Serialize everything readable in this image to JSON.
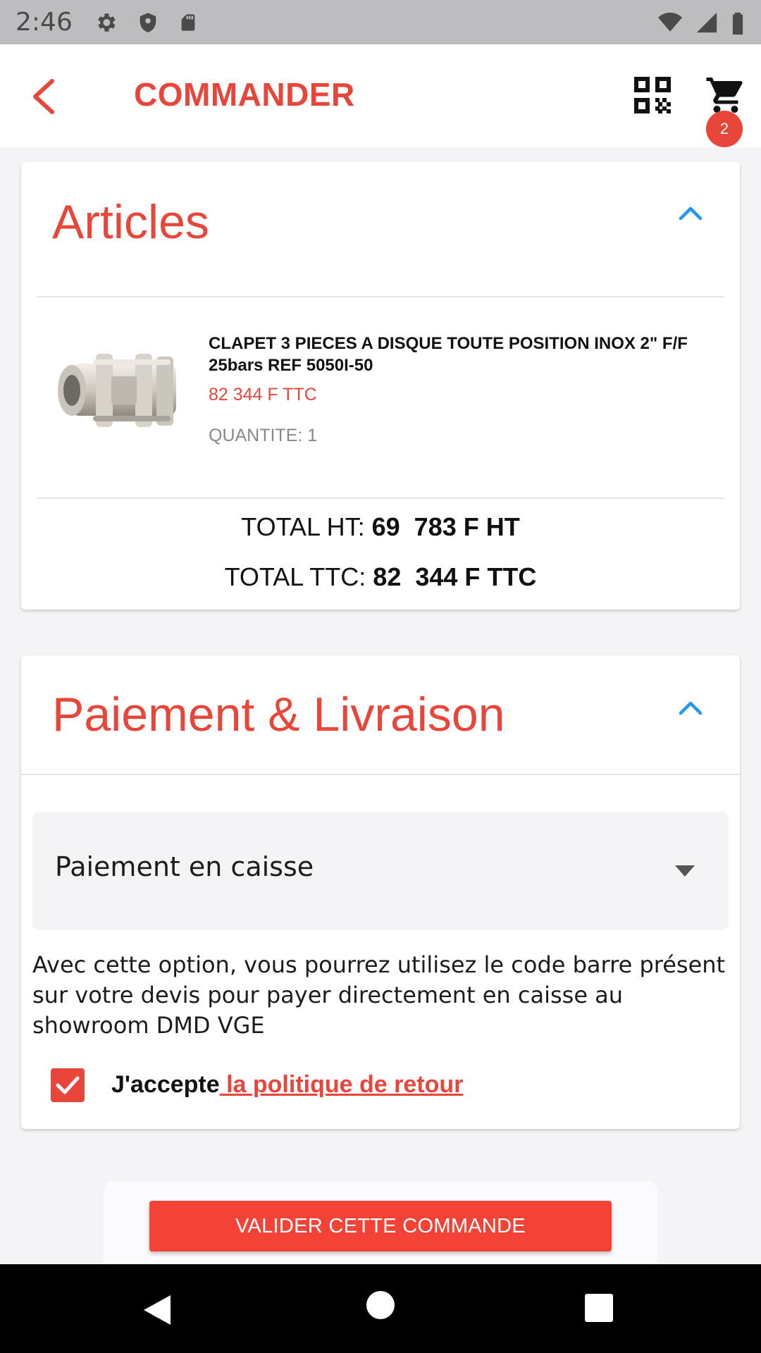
{
  "status_bar": {
    "time": "2:46"
  },
  "app_bar": {
    "title": "COMMANDER",
    "cart_count": "2"
  },
  "articles": {
    "title": "Articles",
    "items": [
      {
        "name": "CLAPET 3 PIECES A DISQUE TOUTE POSITION INOX 2\" F/F 25bars REF 5050I-50",
        "price": "82 344 F TTC",
        "quantity": "QUANTITE: 1"
      }
    ],
    "total_ht_label": "TOTAL HT:",
    "total_ht_value": "69  783 F HT",
    "total_ttc_label": "TOTAL TTC:",
    "total_ttc_value": "82  344 F TTC"
  },
  "payment": {
    "title": "Paiement & Livraison",
    "selected_method": "Paiement en caisse",
    "description": "Avec cette option, vous pourrez utilisez le code barre présent sur votre devis pour payer directement en caisse au showroom DMD VGE",
    "accept_text": "J'accepte",
    "accept_link": " la politique de retour",
    "accept_checked": true
  },
  "actions": {
    "validate_label": "VALIDER CETTE COMMANDE"
  },
  "colors": {
    "accent": "#e8463a",
    "button": "#f44336",
    "chevron": "#2196f3"
  }
}
